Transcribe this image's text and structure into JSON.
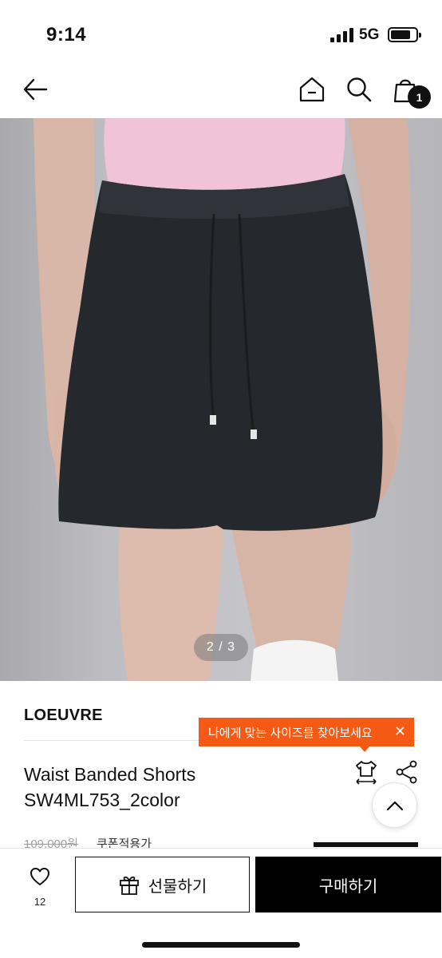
{
  "status_bar": {
    "time": "9:14",
    "network": "5G"
  },
  "nav": {
    "cart_count": "1"
  },
  "product_image": {
    "counter": "2 / 3"
  },
  "product": {
    "brand": "LOEUVRE",
    "title_line1": "Waist Banded Shorts",
    "title_line2": "SW4ML753_2color",
    "original_price": "109,000원",
    "coupon_label": "쿠폰적용가"
  },
  "tooltip": {
    "text": "나에게 맞는 사이즈를 찾아보세요",
    "close": "✕"
  },
  "bottom_bar": {
    "like_count": "12",
    "gift_label": "선물하기",
    "buy_label": "구매하기"
  },
  "colors": {
    "accent": "#f45a14",
    "primary": "#000000"
  }
}
